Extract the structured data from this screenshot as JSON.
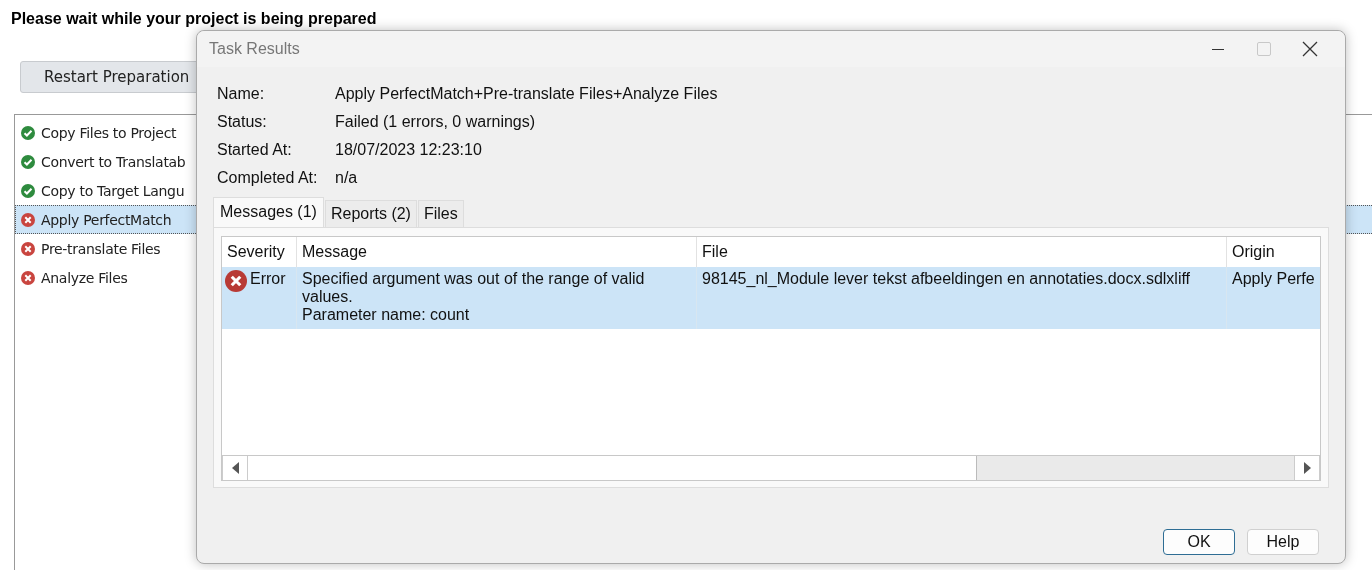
{
  "page": {
    "heading": "Please wait while your project is being prepared",
    "restart_button": "Restart Preparation",
    "tasks": [
      {
        "label": "Copy Files to Project",
        "kind": "done",
        "selected": false
      },
      {
        "label": "Convert to Translatab",
        "kind": "done",
        "selected": false
      },
      {
        "label": "Copy to Target Langu",
        "kind": "done",
        "selected": false
      },
      {
        "label": "Apply PerfectMatch",
        "kind": "failed",
        "selected": true
      },
      {
        "label": "Pre-translate Files",
        "kind": "failed",
        "selected": false
      },
      {
        "label": "Analyze Files",
        "kind": "failed",
        "selected": false
      }
    ]
  },
  "dialog": {
    "title": "Task Results",
    "maximize_disabled": true,
    "fields": [
      {
        "label": "Name:",
        "value": "Apply PerfectMatch+Pre-translate Files+Analyze Files"
      },
      {
        "label": "Status:",
        "value": "Failed (1 errors, 0 warnings)"
      },
      {
        "label": "Started At:",
        "value": "18/07/2023 12:23:10"
      },
      {
        "label": "Completed At:",
        "value": "n/a"
      }
    ],
    "tabs": [
      {
        "label": "Messages (1)",
        "selected": true
      },
      {
        "label": "Reports (2)",
        "selected": false
      },
      {
        "label": "Files",
        "selected": false
      }
    ],
    "table": {
      "columns": [
        "Severity",
        "Message",
        "File",
        "Origin"
      ],
      "rows": [
        {
          "severity": "Error",
          "message": [
            "Specified argument was out of the range of valid values.",
            "Parameter name: count"
          ],
          "file": "98145_nl_Module lever tekst afbeeldingen en annotaties.docx.sdlxliff",
          "origin": "Apply Perfe",
          "selected": true
        }
      ]
    },
    "buttons": [
      {
        "label": "OK",
        "default": true
      },
      {
        "label": "Help",
        "default": false
      }
    ]
  }
}
